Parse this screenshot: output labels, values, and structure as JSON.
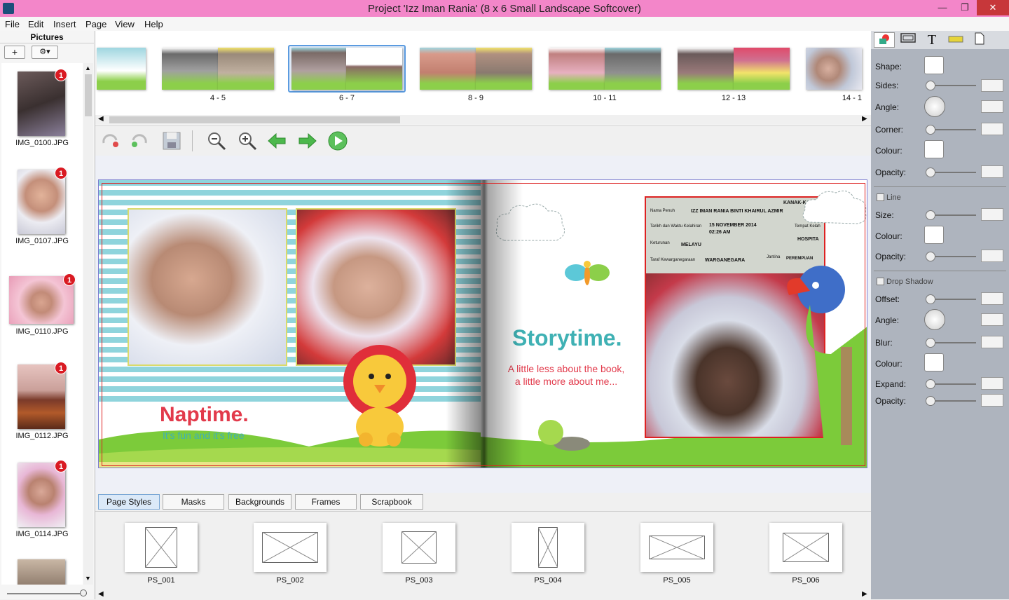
{
  "window": {
    "title": "Project 'Izz Iman Rania' (8 x 6 Small Landscape Softcover)",
    "minimize": "—",
    "restore": "❐",
    "close": "✕"
  },
  "menu": [
    "File",
    "Edit",
    "Insert",
    "Page",
    "View",
    "Help"
  ],
  "pictures_panel": {
    "header": "Pictures",
    "add_label": "+",
    "settings_label": "⚙▾",
    "items": [
      {
        "name": "IMG_0100.JPG",
        "badge": "1"
      },
      {
        "name": "IMG_0107.JPG",
        "badge": "1"
      },
      {
        "name": "IMG_0110.JPG",
        "badge": "1"
      },
      {
        "name": "IMG_0112.JPG",
        "badge": "1"
      },
      {
        "name": "IMG_0114.JPG",
        "badge": "1"
      }
    ]
  },
  "filmstrip": {
    "spreads": [
      "",
      "4 - 5",
      "6 - 7",
      "8 - 9",
      "10 - 11",
      "12 - 13",
      "14 - 1"
    ],
    "selected": "6 - 7"
  },
  "canvas": {
    "left_heading": "Naptime.",
    "left_sub": "It's fun and it's free",
    "right_heading": "Storytime.",
    "right_sub1": "A little less about the book,",
    "right_sub2": "a little more about me...",
    "certificate": {
      "header": "KANAK-KANAK",
      "l1": "Nama Penuh",
      "v1": "IZZ IMAN RANIA BINTI KHAIRUL AZMIR",
      "l2": "Tarikh dan Waktu Kelahiran",
      "v2": "15 NOVEMBER 2014",
      "v2b": "02:26 AM",
      "l3": "Keturunan",
      "v3": "MELAYU",
      "l4": "Taraf Kewarganegaraan",
      "v4": "WARGANEGARA",
      "r1": "Tempat Kelah",
      "r2": "HOSPITA",
      "r3": "Jantina",
      "r4": "PEREMPUAN"
    }
  },
  "tabs": [
    "Page Styles",
    "Masks",
    "Backgrounds",
    "Frames",
    "Scrapbook"
  ],
  "active_tab": "Page Styles",
  "page_styles": [
    "PS_001",
    "PS_002",
    "PS_003",
    "PS_004",
    "PS_005",
    "PS_006"
  ],
  "properties": {
    "shape": "Shape:",
    "sides": "Sides:",
    "angle": "Angle:",
    "corner": "Corner:",
    "colour": "Colour:",
    "opacity": "Opacity:",
    "line_section": "Line",
    "size": "Size:",
    "line_colour": "Colour:",
    "line_opacity": "Opacity:",
    "shadow_section": "Drop Shadow",
    "offset": "Offset:",
    "shadow_angle": "Angle:",
    "blur": "Blur:",
    "shadow_colour": "Colour:",
    "expand": "Expand:",
    "shadow_opacity": "Opacity:"
  },
  "colors": {
    "titlebar": "#f386c9",
    "accent_red": "#e23a4b",
    "accent_teal": "#3fb1b4",
    "panel_bg": "#aeb4be"
  }
}
